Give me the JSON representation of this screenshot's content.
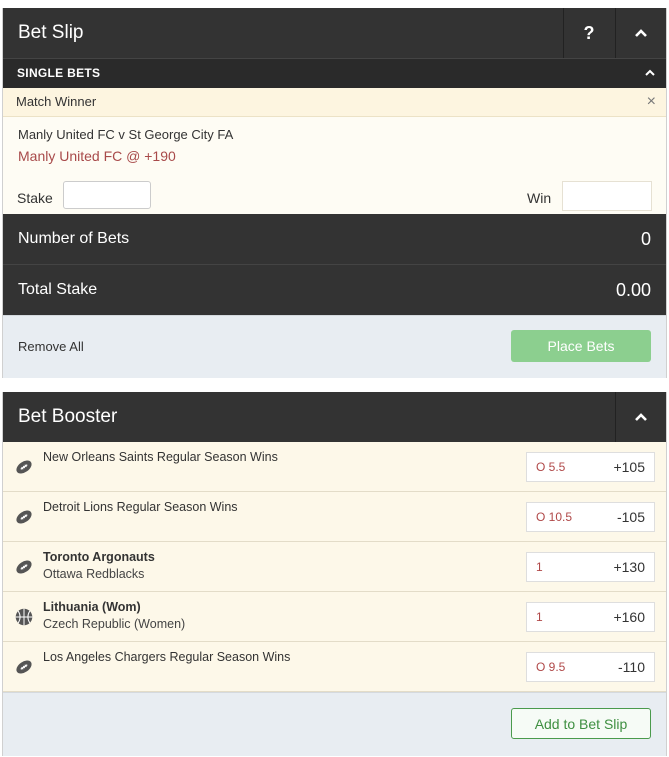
{
  "betslip": {
    "title": "Bet Slip",
    "help_label": "?",
    "section_label": "SINGLE BETS",
    "market": "Match Winner",
    "close_symbol": "×",
    "event": "Manly United FC v St George City FA",
    "selection": "Manly United FC @ +190",
    "stake_label": "Stake",
    "stake_value": "",
    "win_label": "Win",
    "number_of_bets_label": "Number of Bets",
    "number_of_bets_value": "0",
    "total_stake_label": "Total Stake",
    "total_stake_value": "0.00",
    "remove_all_label": "Remove All",
    "place_bets_label": "Place Bets"
  },
  "booster": {
    "title": "Bet Booster",
    "rows": [
      {
        "icon": "football-icon",
        "line1": "New Orleans Saints Regular Season Wins",
        "line2": "",
        "bold": false,
        "line": "O 5.5",
        "price": "+105"
      },
      {
        "icon": "football-icon",
        "line1": "Detroit Lions Regular Season Wins",
        "line2": "",
        "bold": false,
        "line": "O 10.5",
        "price": "-105"
      },
      {
        "icon": "football-icon",
        "line1": "Toronto Argonauts",
        "line2": "Ottawa Redblacks",
        "bold": true,
        "line": "1",
        "price": "+130"
      },
      {
        "icon": "basketball-icon",
        "line1": "Lithuania (Wom)",
        "line2": "Czech Republic (Women)",
        "bold": true,
        "line": "1",
        "price": "+160"
      },
      {
        "icon": "football-icon",
        "line1": "Los Angeles Chargers Regular Season Wins",
        "line2": "",
        "bold": false,
        "line": "O 9.5",
        "price": "-110"
      }
    ],
    "add_label": "Add to Bet Slip"
  },
  "colors": {
    "header_bg": "#333333",
    "market_bg": "#fdf5e0",
    "selection_text": "#a84a4a",
    "place_button": "#8ccf8f",
    "add_button_text": "#3e8f41",
    "footer_bg": "#e8edf2"
  }
}
